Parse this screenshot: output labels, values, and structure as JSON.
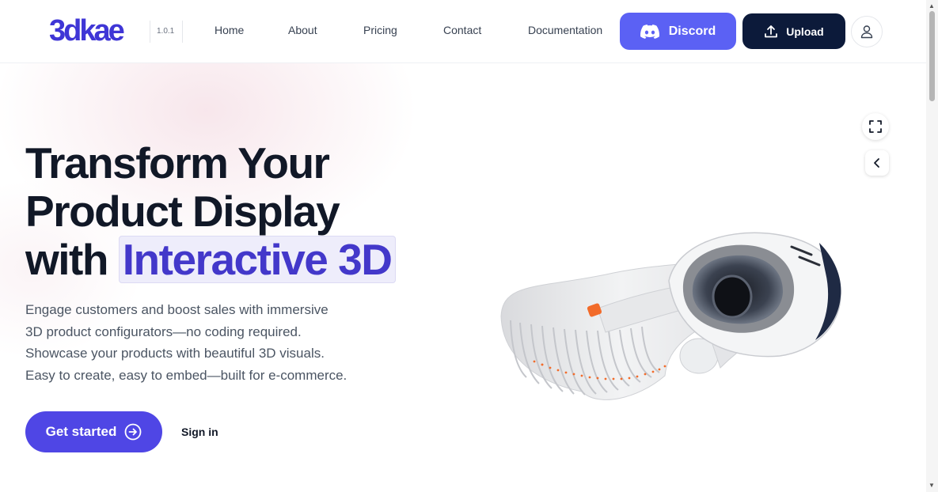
{
  "header": {
    "logo_text": "3dkae",
    "version": "1.0.1",
    "nav": [
      "Home",
      "About",
      "Pricing",
      "Contact",
      "Documentation"
    ],
    "discord_label": "Discord",
    "upload_label": "Upload"
  },
  "hero": {
    "headline_line1": "Transform Your",
    "headline_line2": "Product Display",
    "headline_line3_prefix": "with",
    "headline_highlight": "Interactive 3D",
    "subtext": [
      "Engage customers and boost sales with immersive",
      "3D product configurators—no coding required.",
      "Showcase your products with beautiful 3D visuals.",
      "Easy to create, easy to embed—built for e-commerce."
    ],
    "cta_label": "Get started",
    "signin_label": "Sign in"
  },
  "colors": {
    "brand": "#4f46e5",
    "discord": "#5b61f4",
    "upload": "#0c1a3a",
    "accent_orange": "#f26b2a"
  },
  "icons": {
    "discord": "discord-icon",
    "upload": "upload-icon",
    "user": "user-icon",
    "arrow": "arrow-right-circle-icon",
    "fullscreen": "fullscreen-icon",
    "collapse": "chevron-left-icon"
  }
}
